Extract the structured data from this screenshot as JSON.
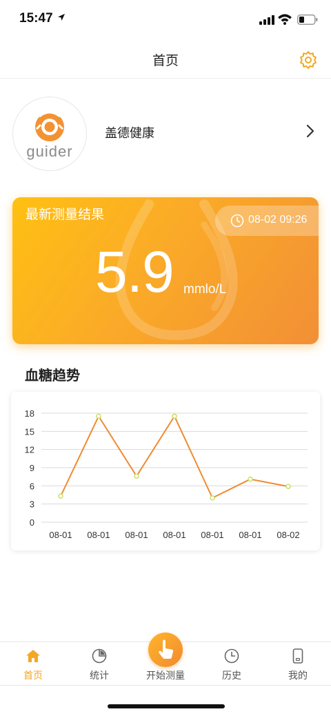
{
  "status_bar": {
    "time": "15:47"
  },
  "header": {
    "title": "首页"
  },
  "profile": {
    "brand_word": "guider",
    "name": "盖德健康"
  },
  "result_card": {
    "label": "最新测量结果",
    "timestamp": "08-02 09:26",
    "value": "5.9",
    "unit": "mmlo/L"
  },
  "trend": {
    "title": "血糖趋势"
  },
  "chart_data": {
    "type": "line",
    "categories": [
      "08-01",
      "08-01",
      "08-01",
      "08-01",
      "08-01",
      "08-01",
      "08-02"
    ],
    "series": [
      {
        "values": [
          4.3,
          17.5,
          7.6,
          17.5,
          4.0,
          7.1,
          5.9
        ]
      }
    ],
    "y_ticks": [
      0,
      3,
      6,
      9,
      12,
      15,
      18
    ],
    "ylim": [
      0,
      18
    ],
    "grid": true,
    "line_color": "#f08a30",
    "marker_color": "#c8e06a"
  },
  "tab_bar": {
    "items": [
      {
        "label": "首页",
        "icon": "home-icon",
        "active": true
      },
      {
        "label": "统计",
        "icon": "pie-chart-icon",
        "active": false
      },
      {
        "label": "开始测量",
        "icon": "tap-hand-icon",
        "active": false
      },
      {
        "label": "历史",
        "icon": "clock-icon",
        "active": false
      },
      {
        "label": "我的",
        "icon": "phone-icon",
        "active": false
      }
    ]
  },
  "colors": {
    "accent": "#f5a623",
    "card_start": "#ffc012",
    "card_end": "#f28f36"
  }
}
